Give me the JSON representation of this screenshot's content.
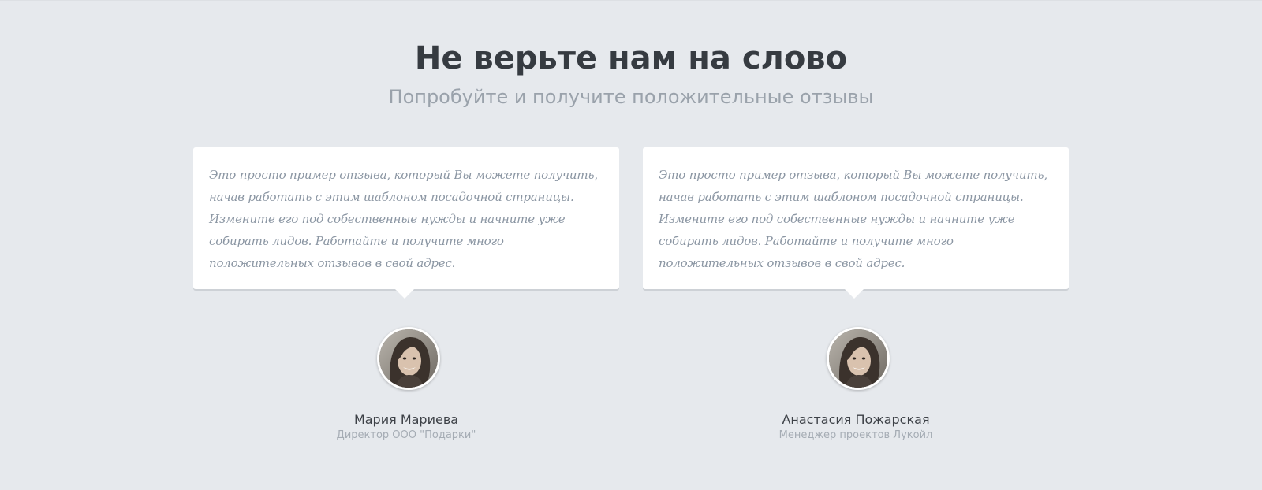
{
  "section": {
    "title": "Не верьте нам на слово",
    "subtitle": "Попробуйте и получите положительные отзывы"
  },
  "testimonials": [
    {
      "quote": "Это просто пример отзыва, который Вы можете получить, начав работать с этим шаблоном посадочной страницы. Измените его под собественные нужды и начните уже собирать лидов. Работайте и получите много положительных отзывов в свой адрес.",
      "name": "Мария Мариева",
      "role": "Директор ООО \"Подарки\"",
      "avatar_icon": "person-photo"
    },
    {
      "quote": "Это просто пример отзыва, который Вы можете получить, начав работать с этим шаблоном посадочной страницы. Измените его под собественные нужды и начните уже собирать лидов. Работайте и получите много положительных отзывов в свой адрес.",
      "name": "Анастасия Пожарская",
      "role": "Менеджер проектов Лукойл",
      "avatar_icon": "person-photo"
    }
  ],
  "colors": {
    "background": "#e6e9ed",
    "card": "#ffffff",
    "title": "#363b41",
    "subtitle": "#9aa2ab",
    "quote_text": "#8b96a3",
    "name": "#3d4147",
    "role": "#a5acb4"
  }
}
